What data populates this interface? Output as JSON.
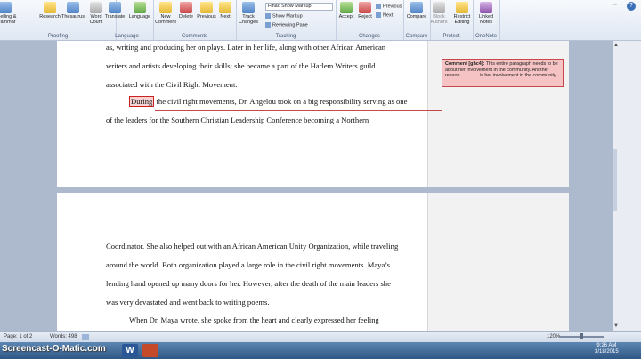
{
  "ribbon": {
    "proofing": {
      "label": "Proofing",
      "items": [
        "Spelling & Grammar",
        "Research",
        "Thesaurus",
        "Word Count"
      ]
    },
    "language": {
      "label": "Language",
      "items": [
        "Translate",
        "Language"
      ]
    },
    "comments": {
      "label": "Comments",
      "items": [
        "New Comment",
        "Delete",
        "Previous",
        "Next"
      ]
    },
    "tracking": {
      "label": "Tracking",
      "track_changes": "Track Changes",
      "display_for_review": "Final: Show Markup",
      "show_markup": "Show Markup",
      "reviewing_pane": "Reviewing Pane"
    },
    "changes": {
      "label": "Changes",
      "items": [
        "Accept",
        "Reject"
      ],
      "previous": "Previous",
      "next": "Next"
    },
    "compare": {
      "label": "Compare",
      "items": [
        "Compare"
      ]
    },
    "protect": {
      "label": "Protect",
      "items": [
        "Block Authors",
        "Restrict Editing"
      ]
    },
    "onenote": {
      "label": "OneNote",
      "items": [
        "Linked Notes"
      ]
    }
  },
  "page1": {
    "lines": [
      "as, writing and producing her on plays. Later in her life, along with other African American",
      "writers and artists developing their skills; she became a part of the Harlem Writers guild",
      "associated with the Civil Right Movement."
    ],
    "para2_highlight": "During",
    "para2_rest": " the civil right movements, Dr. Angelou took on a big responsibility serving as one",
    "para2_line2": "of the leaders for the Southern Christian Leadership Conference becoming a Northern"
  },
  "page2": {
    "lines": [
      "Coordinator. She also helped out with an African American Unity Organization, while traveling",
      "around the world. Both organization played a large role in the civil right movements. Maya’s",
      "lending hand opened up many doors for her.  However, after the death of the main leaders she",
      "was very devastated and went back to writing poems.",
      "When Dr. Maya wrote, she spoke from the heart and clearly expressed her feeling"
    ]
  },
  "comment": {
    "label": "Comment [ghc4]:",
    "text": " This entire paragraph needs to be about her involvement in the community. Another reason ..............is her involvement in the community."
  },
  "status": {
    "page": "Page: 1 of 2",
    "words": "Words: 498",
    "zoom": "120%"
  },
  "taskbar": {
    "watermark": "Screencast-O-Matic.com",
    "time": "9:26 AM",
    "date": "3/18/2015"
  },
  "colors": {
    "comment_border": "#c8474b",
    "comment_fill": "#f5c3c3",
    "doc_background": "#adb9cd"
  }
}
